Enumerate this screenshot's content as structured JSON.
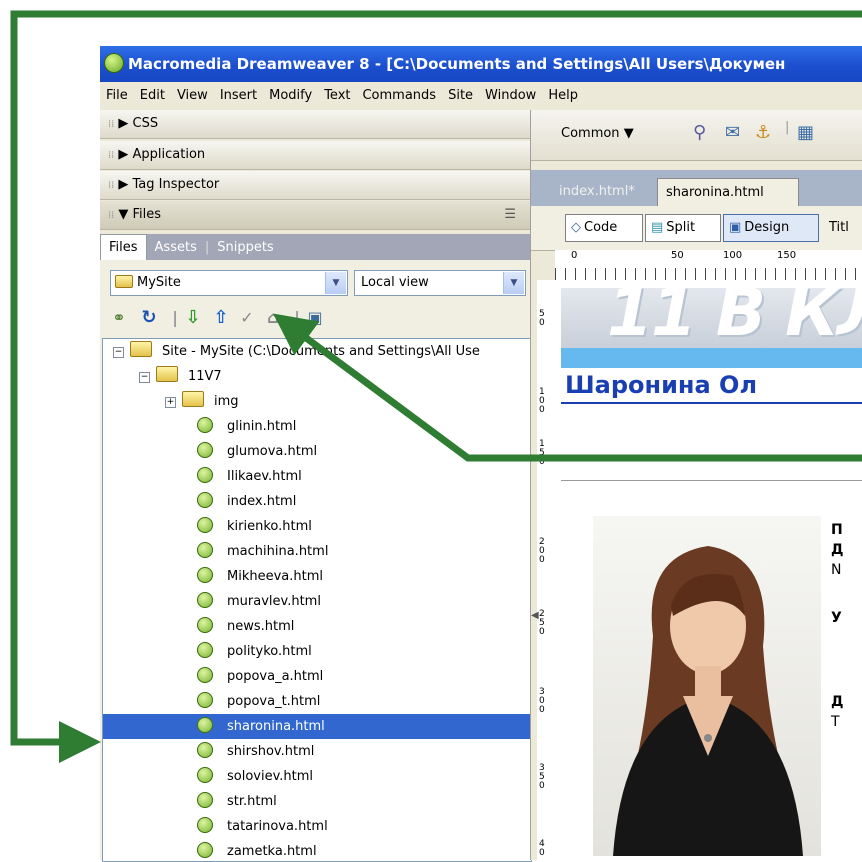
{
  "window": {
    "title": "Macromedia Dreamweaver 8 - [C:\\Documents and Settings\\All Users\\Докумен"
  },
  "menu": [
    "File",
    "Edit",
    "View",
    "Insert",
    "Modify",
    "Text",
    "Commands",
    "Site",
    "Window",
    "Help"
  ],
  "panels": {
    "css": "CSS",
    "application": "Application",
    "tag_inspector": "Tag Inspector",
    "files": "Files"
  },
  "files_tabs": [
    "Files",
    "Assets",
    "Snippets"
  ],
  "site_select": "MySite",
  "view_select": "Local view",
  "tree": {
    "root": "Site - MySite (C:\\Documents and Settings\\All Use",
    "folder": "11V7",
    "subfolder": "img",
    "files": [
      "glinin.html",
      "glumova.html",
      "Ilikaev.html",
      "index.html",
      "kirienko.html",
      "machihina.html",
      "Mikheeva.html",
      "muravlev.html",
      "news.html",
      "polityko.html",
      "popova_a.html",
      "popova_t.html",
      "sharonina.html",
      "shirshov.html",
      "soloviev.html",
      "str.html",
      "tatarinova.html",
      "zametka.html"
    ],
    "selected": "sharonina.html"
  },
  "insert_bar": {
    "category": "Common"
  },
  "doc_tabs": [
    "index.html*",
    "sharonina.html"
  ],
  "view_buttons": {
    "code": "Code",
    "split": "Split",
    "design": "Design",
    "title": "Titl"
  },
  "ruler_h": [
    "0",
    "50",
    "100",
    "150"
  ],
  "ruler_v": [
    "5\n0",
    "1\n0\n0",
    "1\n5\n0",
    "2\n0\n0",
    "2\n5\n0",
    "3\n0\n0",
    "3\n5\n0",
    "4\n0"
  ],
  "page": {
    "banner_text": "11 В КЛ",
    "heading": "Шаронина Ол",
    "side_letters": [
      "П",
      "Д",
      "N",
      "У",
      "Д",
      "Т"
    ]
  },
  "colors": {
    "arrow": "#2e7d32",
    "selection": "#3167cf",
    "heading": "#1a3fb3"
  }
}
